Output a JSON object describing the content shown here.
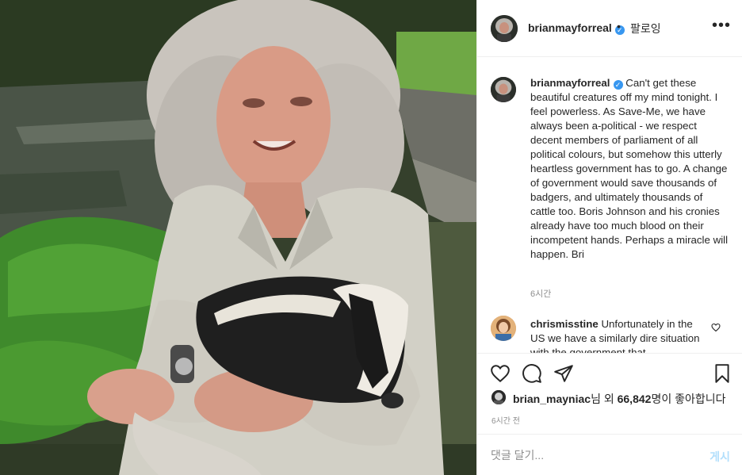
{
  "post": {
    "image_alt": "Man with grey curly hair in a light shirt holding a badger in a garden"
  },
  "header": {
    "username": "brianmayforreal",
    "verified_badge": "verified-badge-icon",
    "separator": "•",
    "follow_status": "팔로잉",
    "more_icon": "more-options-icon",
    "more_label": "•••"
  },
  "caption": {
    "username": "brianmayforreal",
    "text": "Can't get these beautiful creatures off my mind tonight. I feel powerless. As Save-Me, we have always been a-political - we respect decent members of parliament of all political colours, but somehow this utterly heartless government has to go. A change of government would save thousands of badgers, and ultimately thousands of cattle too. Boris Johnson and his cronies already have too much blood on their incompetent hands. Perhaps a miracle will happen. Bri",
    "time": "6시간"
  },
  "comments": [
    {
      "username": "chrismisstine",
      "text": "Unfortunately in the US we have a similarly dire situation with the government that"
    }
  ],
  "actions": {
    "like_icon": "heart-icon",
    "comment_icon": "comment-icon",
    "share_icon": "share-icon",
    "save_icon": "bookmark-icon"
  },
  "likes": {
    "by_user": "brian_mayniac",
    "middle": "님 외 ",
    "count": "66,842",
    "suffix": "명이 좋아합니다"
  },
  "post_time": "6시간 전",
  "add_comment": {
    "placeholder": "댓글 달기...",
    "post_label": "게시"
  },
  "colors": {
    "verified": "#3897f0",
    "post_button_disabled": "#b2dffc",
    "secondary_text": "#8e8e8e",
    "divider": "#efefef"
  }
}
